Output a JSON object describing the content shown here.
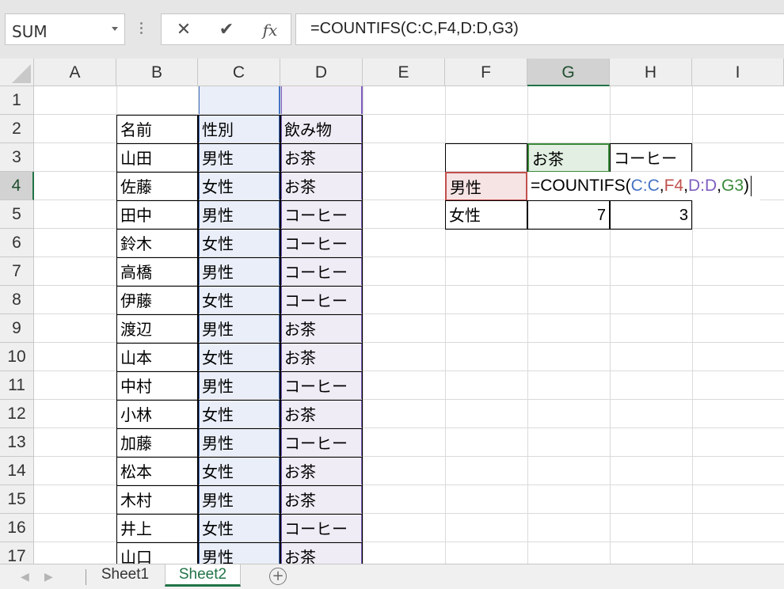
{
  "name_box": {
    "value": "SUM"
  },
  "formula_bar": {
    "cancel_icon": "✕",
    "enter_icon": "✔",
    "fx_label": "fx",
    "formula": "=COUNTIFS(C:C,F4,D:D,G3)"
  },
  "columns": [
    "A",
    "B",
    "C",
    "D",
    "E",
    "F",
    "G",
    "H",
    "I"
  ],
  "active_column": "G",
  "rows": [
    "1",
    "2",
    "3",
    "4",
    "5",
    "6",
    "7",
    "8",
    "9",
    "10",
    "11",
    "12",
    "13",
    "14",
    "15",
    "16",
    "17"
  ],
  "active_row": "4",
  "table": {
    "headers": [
      "名前",
      "性別",
      "飲み物"
    ],
    "rows": [
      [
        "山田",
        "男性",
        "お茶"
      ],
      [
        "佐藤",
        "女性",
        "お茶"
      ],
      [
        "田中",
        "男性",
        "コーヒー"
      ],
      [
        "鈴木",
        "女性",
        "コーヒー"
      ],
      [
        "高橋",
        "男性",
        "コーヒー"
      ],
      [
        "伊藤",
        "女性",
        "コーヒー"
      ],
      [
        "渡辺",
        "男性",
        "お茶"
      ],
      [
        "山本",
        "女性",
        "お茶"
      ],
      [
        "中村",
        "男性",
        "コーヒー"
      ],
      [
        "小林",
        "女性",
        "お茶"
      ],
      [
        "加藤",
        "男性",
        "コーヒー"
      ],
      [
        "松本",
        "女性",
        "お茶"
      ],
      [
        "木村",
        "男性",
        "お茶"
      ],
      [
        "井上",
        "女性",
        "コーヒー"
      ],
      [
        "山口",
        "男性",
        "お茶"
      ]
    ]
  },
  "summary": {
    "col_headers": [
      "お茶",
      "コーヒー"
    ],
    "row_labels": [
      "男性",
      "女性"
    ],
    "female_values": [
      "7",
      "3"
    ],
    "edit_formula_parts": [
      {
        "text": "=COUNTIFS(",
        "color": "#000000"
      },
      {
        "text": "C:C",
        "color": "#4472c4"
      },
      {
        "text": ",",
        "color": "#000000"
      },
      {
        "text": "F4",
        "color": "#c0504d"
      },
      {
        "text": ",",
        "color": "#000000"
      },
      {
        "text": "D:D",
        "color": "#7f5fc0"
      },
      {
        "text": ",",
        "color": "#000000"
      },
      {
        "text": "G3",
        "color": "#3a8a3a"
      },
      {
        "text": ")",
        "color": "#000000"
      }
    ]
  },
  "range_colors": {
    "C": "#4472c4",
    "D": "#7f5fc0",
    "F4": "#c0504d",
    "G3": "#3a8a3a"
  },
  "sheet_tabs": {
    "tabs": [
      "Sheet1",
      "Sheet2"
    ],
    "active": "Sheet2",
    "add_icon": "+"
  }
}
